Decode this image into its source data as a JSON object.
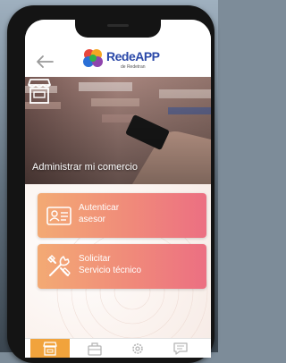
{
  "app": {
    "logo_text": "RedeAPP",
    "logo_subtext": "de Redetran"
  },
  "hero": {
    "label": "Administrar mi comercio"
  },
  "cards": [
    {
      "line1": "Autenticar",
      "line2": "asesor",
      "icon": "id-card-icon"
    },
    {
      "line1": "Solicitar",
      "line2": "Servicio técnico",
      "icon": "tools-icon"
    }
  ],
  "bottom_nav": [
    {
      "icon": "store-icon",
      "active": true
    },
    {
      "icon": "briefcase-icon",
      "active": false
    },
    {
      "icon": "gear-icon",
      "active": false
    },
    {
      "icon": "chat-icon",
      "active": false
    }
  ],
  "colors": {
    "brand_blue": "#2a48a8",
    "accent_orange": "#f1a33c",
    "card_gradient_start": "#f3aa74",
    "card_gradient_end": "#ec6f82"
  }
}
